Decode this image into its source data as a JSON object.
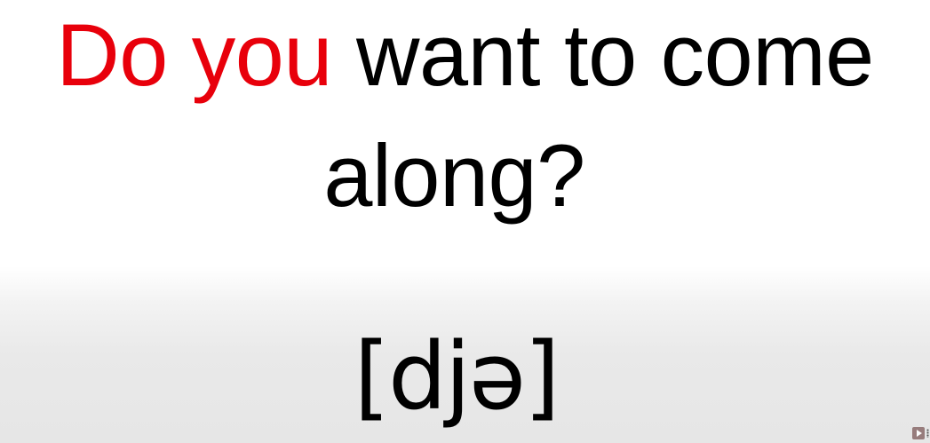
{
  "slide": {
    "line1": {
      "highlight": "Do you",
      "rest": " want to come"
    },
    "line2": "along?",
    "pronunciation": "[djə]"
  },
  "colors": {
    "highlight": "#e8000b",
    "text": "#000000",
    "background_top": "#ffffff",
    "background_bottom": "#e6e6e6"
  },
  "icons": {
    "corner_icon": "youtube-icon"
  }
}
